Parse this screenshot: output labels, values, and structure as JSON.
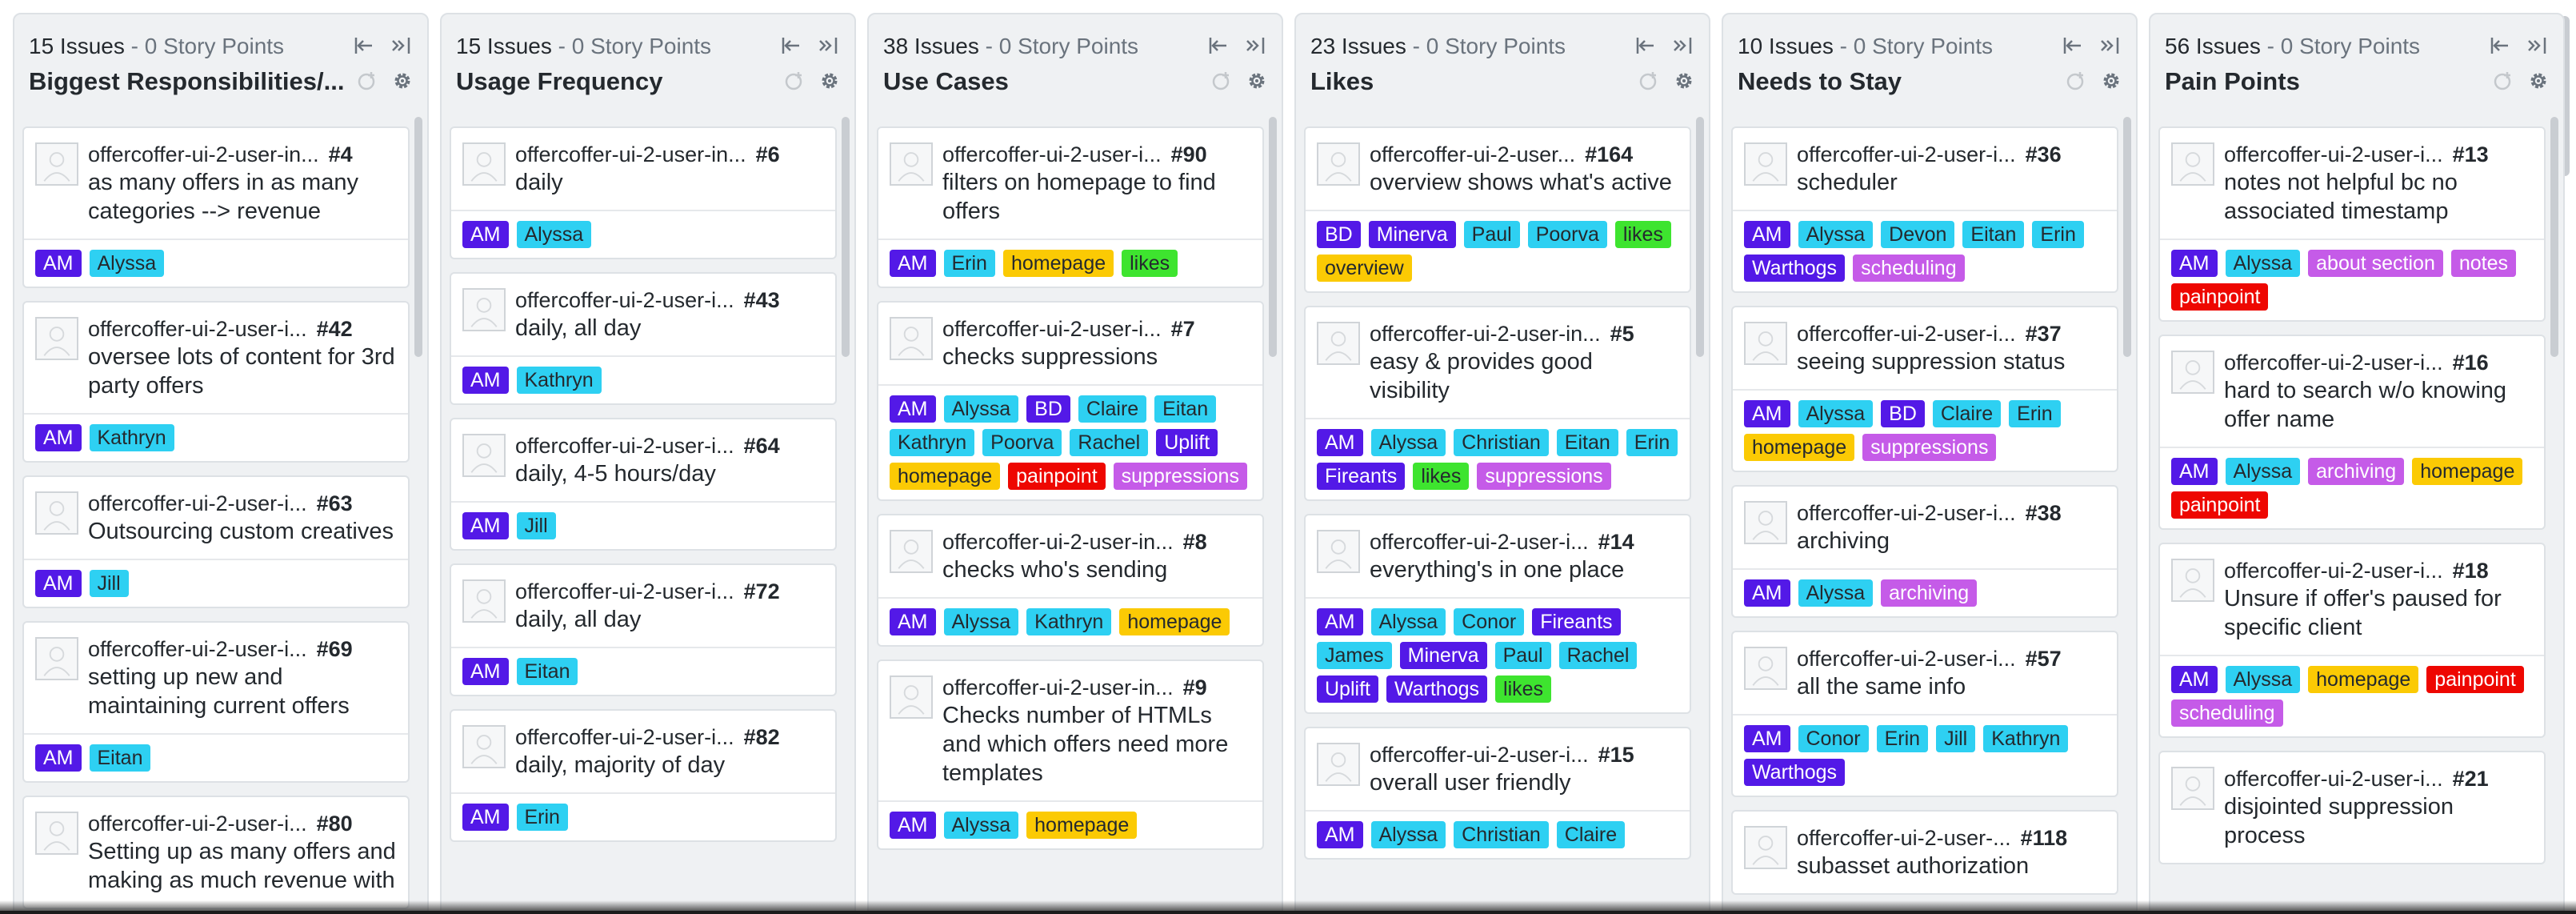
{
  "colors": {
    "column_bg": "#eff1f3",
    "card_bg": "#ffffff",
    "label_am": "#5319e7",
    "label_person": "#2ed0f2",
    "label_purple": "#5319e7",
    "label_homepage": "#fbca04",
    "label_likes": "#3ee42f",
    "label_painpoint": "#ee0701",
    "label_magenta": "#c55be8"
  },
  "icons": {
    "avatar": "avatar-placeholder-icon",
    "collapse_left": "collapse-left-icon",
    "collapse_right": "collapse-right-icon",
    "add": "add-card-icon",
    "settings": "gear-icon"
  },
  "columns": [
    {
      "issues": "15 Issues",
      "separator": " - ",
      "points": "0 Story Points",
      "title": "Biggest Responsibilities/...",
      "cards": [
        {
          "repo": "offercoffer-ui-2-user-in...",
          "num": "#4",
          "title": "as many offers in as many categories --> revenue",
          "labels": [
            {
              "text": "AM",
              "bg": "#5319e7",
              "fg": "#ffffff"
            },
            {
              "text": "Alyssa",
              "bg": "#2ed0f2",
              "fg": "#24292e"
            }
          ]
        },
        {
          "repo": "offercoffer-ui-2-user-i...",
          "num": "#42",
          "title": "oversee lots of content for 3rd party offers",
          "labels": [
            {
              "text": "AM",
              "bg": "#5319e7",
              "fg": "#ffffff"
            },
            {
              "text": "Kathryn",
              "bg": "#2ed0f2",
              "fg": "#24292e"
            }
          ]
        },
        {
          "repo": "offercoffer-ui-2-user-i...",
          "num": "#63",
          "title": "Outsourcing custom creatives",
          "labels": [
            {
              "text": "AM",
              "bg": "#5319e7",
              "fg": "#ffffff"
            },
            {
              "text": "Jill",
              "bg": "#2ed0f2",
              "fg": "#24292e"
            }
          ]
        },
        {
          "repo": "offercoffer-ui-2-user-i...",
          "num": "#69",
          "title": "setting up new and maintaining current offers",
          "labels": [
            {
              "text": "AM",
              "bg": "#5319e7",
              "fg": "#ffffff"
            },
            {
              "text": "Eitan",
              "bg": "#2ed0f2",
              "fg": "#24292e"
            }
          ]
        },
        {
          "repo": "offercoffer-ui-2-user-i...",
          "num": "#80",
          "title": "Setting up as many offers and making as much revenue with",
          "labels": []
        }
      ]
    },
    {
      "issues": "15 Issues",
      "separator": " - ",
      "points": "0 Story Points",
      "title": "Usage Frequency",
      "cards": [
        {
          "repo": "offercoffer-ui-2-user-in...",
          "num": "#6",
          "title": "daily",
          "labels": [
            {
              "text": "AM",
              "bg": "#5319e7",
              "fg": "#ffffff"
            },
            {
              "text": "Alyssa",
              "bg": "#2ed0f2",
              "fg": "#24292e"
            }
          ]
        },
        {
          "repo": "offercoffer-ui-2-user-i...",
          "num": "#43",
          "title": "daily, all day",
          "labels": [
            {
              "text": "AM",
              "bg": "#5319e7",
              "fg": "#ffffff"
            },
            {
              "text": "Kathryn",
              "bg": "#2ed0f2",
              "fg": "#24292e"
            }
          ]
        },
        {
          "repo": "offercoffer-ui-2-user-i...",
          "num": "#64",
          "title": "daily, 4-5 hours/day",
          "labels": [
            {
              "text": "AM",
              "bg": "#5319e7",
              "fg": "#ffffff"
            },
            {
              "text": "Jill",
              "bg": "#2ed0f2",
              "fg": "#24292e"
            }
          ]
        },
        {
          "repo": "offercoffer-ui-2-user-i...",
          "num": "#72",
          "title": "daily, all day",
          "labels": [
            {
              "text": "AM",
              "bg": "#5319e7",
              "fg": "#ffffff"
            },
            {
              "text": "Eitan",
              "bg": "#2ed0f2",
              "fg": "#24292e"
            }
          ]
        },
        {
          "repo": "offercoffer-ui-2-user-i...",
          "num": "#82",
          "title": "daily, majority of day",
          "labels": [
            {
              "text": "AM",
              "bg": "#5319e7",
              "fg": "#ffffff"
            },
            {
              "text": "Erin",
              "bg": "#2ed0f2",
              "fg": "#24292e"
            }
          ]
        }
      ]
    },
    {
      "issues": "38 Issues",
      "separator": " - ",
      "points": "0 Story Points",
      "title": "Use Cases",
      "cards": [
        {
          "repo": "offercoffer-ui-2-user-i...",
          "num": "#90",
          "title": "filters on homepage to find offers",
          "labels": [
            {
              "text": "AM",
              "bg": "#5319e7",
              "fg": "#ffffff"
            },
            {
              "text": "Erin",
              "bg": "#2ed0f2",
              "fg": "#24292e"
            },
            {
              "text": "homepage",
              "bg": "#fbca04",
              "fg": "#24292e"
            },
            {
              "text": "likes",
              "bg": "#3ee42f",
              "fg": "#24292e"
            }
          ]
        },
        {
          "repo": "offercoffer-ui-2-user-i...",
          "num": "#7",
          "title": "checks suppressions",
          "labels": [
            {
              "text": "AM",
              "bg": "#5319e7",
              "fg": "#ffffff"
            },
            {
              "text": "Alyssa",
              "bg": "#2ed0f2",
              "fg": "#24292e"
            },
            {
              "text": "BD",
              "bg": "#5319e7",
              "fg": "#ffffff"
            },
            {
              "text": "Claire",
              "bg": "#2ed0f2",
              "fg": "#24292e"
            },
            {
              "text": "Eitan",
              "bg": "#2ed0f2",
              "fg": "#24292e"
            },
            {
              "text": "Kathryn",
              "bg": "#2ed0f2",
              "fg": "#24292e"
            },
            {
              "text": "Poorva",
              "bg": "#2ed0f2",
              "fg": "#24292e"
            },
            {
              "text": "Rachel",
              "bg": "#2ed0f2",
              "fg": "#24292e"
            },
            {
              "text": "Uplift",
              "bg": "#5319e7",
              "fg": "#ffffff"
            },
            {
              "text": "homepage",
              "bg": "#fbca04",
              "fg": "#24292e"
            },
            {
              "text": "painpoint",
              "bg": "#ee0701",
              "fg": "#ffffff"
            },
            {
              "text": "suppressions",
              "bg": "#c55be8",
              "fg": "#ffffff"
            }
          ]
        },
        {
          "repo": "offercoffer-ui-2-user-in...",
          "num": "#8",
          "title": "checks who's sending",
          "labels": [
            {
              "text": "AM",
              "bg": "#5319e7",
              "fg": "#ffffff"
            },
            {
              "text": "Alyssa",
              "bg": "#2ed0f2",
              "fg": "#24292e"
            },
            {
              "text": "Kathryn",
              "bg": "#2ed0f2",
              "fg": "#24292e"
            },
            {
              "text": "homepage",
              "bg": "#fbca04",
              "fg": "#24292e"
            }
          ]
        },
        {
          "repo": "offercoffer-ui-2-user-in...",
          "num": "#9",
          "title": "Checks number of HTMLs and which offers need more templates",
          "labels": [
            {
              "text": "AM",
              "bg": "#5319e7",
              "fg": "#ffffff"
            },
            {
              "text": "Alyssa",
              "bg": "#2ed0f2",
              "fg": "#24292e"
            },
            {
              "text": "homepage",
              "bg": "#fbca04",
              "fg": "#24292e"
            }
          ]
        }
      ]
    },
    {
      "issues": "23 Issues",
      "separator": " - ",
      "points": "0 Story Points",
      "title": "Likes",
      "cards": [
        {
          "repo": "offercoffer-ui-2-user...",
          "num": "#164",
          "title": "overview shows what's active",
          "labels": [
            {
              "text": "BD",
              "bg": "#5319e7",
              "fg": "#ffffff"
            },
            {
              "text": "Minerva",
              "bg": "#5319e7",
              "fg": "#ffffff"
            },
            {
              "text": "Paul",
              "bg": "#2ed0f2",
              "fg": "#24292e"
            },
            {
              "text": "Poorva",
              "bg": "#2ed0f2",
              "fg": "#24292e"
            },
            {
              "text": "likes",
              "bg": "#3ee42f",
              "fg": "#24292e"
            },
            {
              "text": "overview",
              "bg": "#fbca04",
              "fg": "#24292e"
            }
          ]
        },
        {
          "repo": "offercoffer-ui-2-user-in...",
          "num": "#5",
          "title": "easy & provides good visibility",
          "labels": [
            {
              "text": "AM",
              "bg": "#5319e7",
              "fg": "#ffffff"
            },
            {
              "text": "Alyssa",
              "bg": "#2ed0f2",
              "fg": "#24292e"
            },
            {
              "text": "Christian",
              "bg": "#2ed0f2",
              "fg": "#24292e"
            },
            {
              "text": "Eitan",
              "bg": "#2ed0f2",
              "fg": "#24292e"
            },
            {
              "text": "Erin",
              "bg": "#2ed0f2",
              "fg": "#24292e"
            },
            {
              "text": "Fireants",
              "bg": "#5319e7",
              "fg": "#ffffff"
            },
            {
              "text": "likes",
              "bg": "#3ee42f",
              "fg": "#24292e"
            },
            {
              "text": "suppressions",
              "bg": "#c55be8",
              "fg": "#ffffff"
            }
          ]
        },
        {
          "repo": "offercoffer-ui-2-user-i...",
          "num": "#14",
          "title": "everything's in one place",
          "labels": [
            {
              "text": "AM",
              "bg": "#5319e7",
              "fg": "#ffffff"
            },
            {
              "text": "Alyssa",
              "bg": "#2ed0f2",
              "fg": "#24292e"
            },
            {
              "text": "Conor",
              "bg": "#2ed0f2",
              "fg": "#24292e"
            },
            {
              "text": "Fireants",
              "bg": "#5319e7",
              "fg": "#ffffff"
            },
            {
              "text": "James",
              "bg": "#2ed0f2",
              "fg": "#24292e"
            },
            {
              "text": "Minerva",
              "bg": "#5319e7",
              "fg": "#ffffff"
            },
            {
              "text": "Paul",
              "bg": "#2ed0f2",
              "fg": "#24292e"
            },
            {
              "text": "Rachel",
              "bg": "#2ed0f2",
              "fg": "#24292e"
            },
            {
              "text": "Uplift",
              "bg": "#5319e7",
              "fg": "#ffffff"
            },
            {
              "text": "Warthogs",
              "bg": "#5319e7",
              "fg": "#ffffff"
            },
            {
              "text": "likes",
              "bg": "#3ee42f",
              "fg": "#24292e"
            }
          ]
        },
        {
          "repo": "offercoffer-ui-2-user-i...",
          "num": "#15",
          "title": "overall user friendly",
          "labels": [
            {
              "text": "AM",
              "bg": "#5319e7",
              "fg": "#ffffff"
            },
            {
              "text": "Alyssa",
              "bg": "#2ed0f2",
              "fg": "#24292e"
            },
            {
              "text": "Christian",
              "bg": "#2ed0f2",
              "fg": "#24292e"
            },
            {
              "text": "Claire",
              "bg": "#2ed0f2",
              "fg": "#24292e"
            }
          ]
        }
      ]
    },
    {
      "issues": "10 Issues",
      "separator": " - ",
      "points": "0 Story Points",
      "title": "Needs to Stay",
      "cards": [
        {
          "repo": "offercoffer-ui-2-user-i...",
          "num": "#36",
          "title": "scheduler",
          "labels": [
            {
              "text": "AM",
              "bg": "#5319e7",
              "fg": "#ffffff"
            },
            {
              "text": "Alyssa",
              "bg": "#2ed0f2",
              "fg": "#24292e"
            },
            {
              "text": "Devon",
              "bg": "#2ed0f2",
              "fg": "#24292e"
            },
            {
              "text": "Eitan",
              "bg": "#2ed0f2",
              "fg": "#24292e"
            },
            {
              "text": "Erin",
              "bg": "#2ed0f2",
              "fg": "#24292e"
            },
            {
              "text": "Warthogs",
              "bg": "#5319e7",
              "fg": "#ffffff"
            },
            {
              "text": "scheduling",
              "bg": "#c55be8",
              "fg": "#ffffff"
            }
          ]
        },
        {
          "repo": "offercoffer-ui-2-user-i...",
          "num": "#37",
          "title": "seeing suppression status",
          "labels": [
            {
              "text": "AM",
              "bg": "#5319e7",
              "fg": "#ffffff"
            },
            {
              "text": "Alyssa",
              "bg": "#2ed0f2",
              "fg": "#24292e"
            },
            {
              "text": "BD",
              "bg": "#5319e7",
              "fg": "#ffffff"
            },
            {
              "text": "Claire",
              "bg": "#2ed0f2",
              "fg": "#24292e"
            },
            {
              "text": "Erin",
              "bg": "#2ed0f2",
              "fg": "#24292e"
            },
            {
              "text": "homepage",
              "bg": "#fbca04",
              "fg": "#24292e"
            },
            {
              "text": "suppressions",
              "bg": "#c55be8",
              "fg": "#ffffff"
            }
          ]
        },
        {
          "repo": "offercoffer-ui-2-user-i...",
          "num": "#38",
          "title": "archiving",
          "labels": [
            {
              "text": "AM",
              "bg": "#5319e7",
              "fg": "#ffffff"
            },
            {
              "text": "Alyssa",
              "bg": "#2ed0f2",
              "fg": "#24292e"
            },
            {
              "text": "archiving",
              "bg": "#c55be8",
              "fg": "#ffffff"
            }
          ]
        },
        {
          "repo": "offercoffer-ui-2-user-i...",
          "num": "#57",
          "title": "all the same info",
          "labels": [
            {
              "text": "AM",
              "bg": "#5319e7",
              "fg": "#ffffff"
            },
            {
              "text": "Conor",
              "bg": "#2ed0f2",
              "fg": "#24292e"
            },
            {
              "text": "Erin",
              "bg": "#2ed0f2",
              "fg": "#24292e"
            },
            {
              "text": "Jill",
              "bg": "#2ed0f2",
              "fg": "#24292e"
            },
            {
              "text": "Kathryn",
              "bg": "#2ed0f2",
              "fg": "#24292e"
            },
            {
              "text": "Warthogs",
              "bg": "#5319e7",
              "fg": "#ffffff"
            }
          ]
        },
        {
          "repo": "offercoffer-ui-2-user-...",
          "num": "#118",
          "title": "subasset authorization",
          "labels": []
        }
      ]
    },
    {
      "issues": "56 Issues",
      "separator": " - ",
      "points": "0 Story Points",
      "title": "Pain Points",
      "cards": [
        {
          "repo": "offercoffer-ui-2-user-i...",
          "num": "#13",
          "title": "notes not helpful bc no associated timestamp",
          "labels": [
            {
              "text": "AM",
              "bg": "#5319e7",
              "fg": "#ffffff"
            },
            {
              "text": "Alyssa",
              "bg": "#2ed0f2",
              "fg": "#24292e"
            },
            {
              "text": "about section",
              "bg": "#c55be8",
              "fg": "#ffffff"
            },
            {
              "text": "notes",
              "bg": "#c55be8",
              "fg": "#ffffff"
            },
            {
              "text": "painpoint",
              "bg": "#ee0701",
              "fg": "#ffffff"
            }
          ]
        },
        {
          "repo": "offercoffer-ui-2-user-i...",
          "num": "#16",
          "title": "hard to search w/o knowing offer name",
          "labels": [
            {
              "text": "AM",
              "bg": "#5319e7",
              "fg": "#ffffff"
            },
            {
              "text": "Alyssa",
              "bg": "#2ed0f2",
              "fg": "#24292e"
            },
            {
              "text": "archiving",
              "bg": "#c55be8",
              "fg": "#ffffff"
            },
            {
              "text": "homepage",
              "bg": "#fbca04",
              "fg": "#24292e"
            },
            {
              "text": "painpoint",
              "bg": "#ee0701",
              "fg": "#ffffff"
            }
          ]
        },
        {
          "repo": "offercoffer-ui-2-user-i...",
          "num": "#18",
          "title": "Unsure if offer's paused for specific client",
          "labels": [
            {
              "text": "AM",
              "bg": "#5319e7",
              "fg": "#ffffff"
            },
            {
              "text": "Alyssa",
              "bg": "#2ed0f2",
              "fg": "#24292e"
            },
            {
              "text": "homepage",
              "bg": "#fbca04",
              "fg": "#24292e"
            },
            {
              "text": "painpoint",
              "bg": "#ee0701",
              "fg": "#ffffff"
            },
            {
              "text": "scheduling",
              "bg": "#c55be8",
              "fg": "#ffffff"
            }
          ]
        },
        {
          "repo": "offercoffer-ui-2-user-i...",
          "num": "#21",
          "title": "disjointed suppression process",
          "labels": []
        }
      ]
    }
  ]
}
